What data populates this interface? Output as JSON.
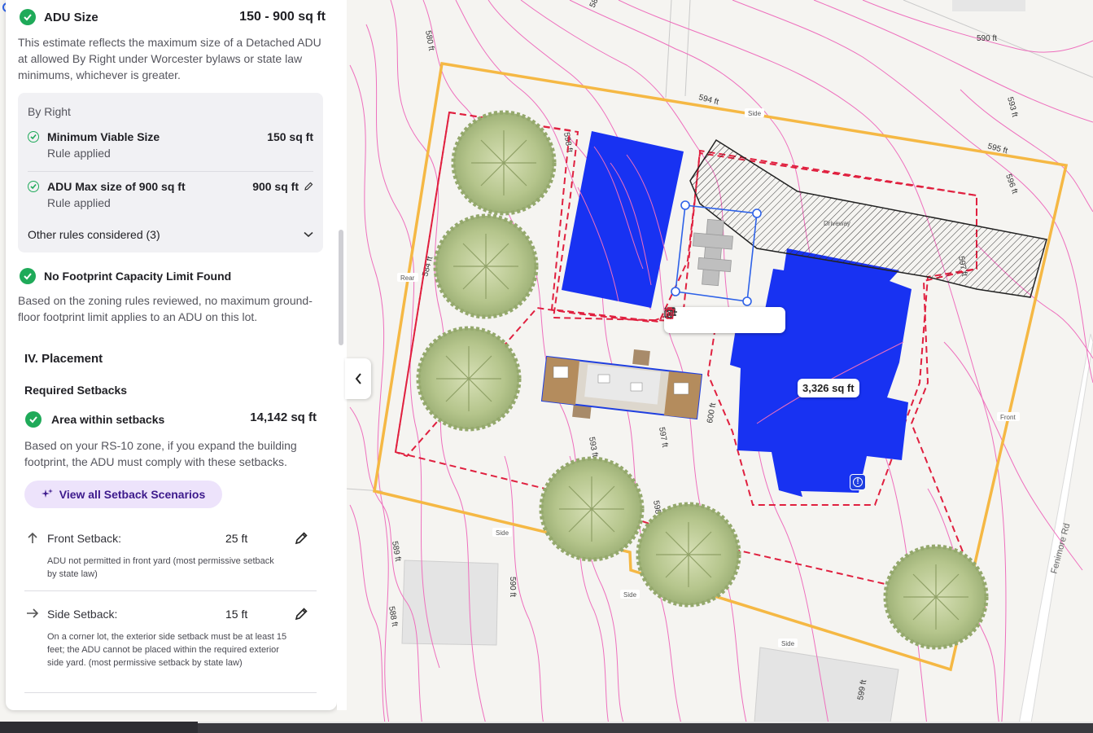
{
  "adu_size": {
    "title": "ADU Size",
    "value": "150 - 900 sq ft",
    "description": "This estimate reflects the maximum size of a Detached ADU at allowed By Right under Worcester bylaws or state law minimums, whichever is greater.",
    "rules_box": {
      "heading": "By Right",
      "rules": [
        {
          "name": "Minimum Viable Size",
          "status": "Rule applied",
          "value": "150 sq ft"
        },
        {
          "name": "ADU Max size of 900 sq ft",
          "status": "Rule applied",
          "value": "900 sq ft"
        }
      ],
      "other_rules_label": "Other rules considered (3)"
    }
  },
  "footprint": {
    "title": "No Footprint Capacity Limit Found",
    "description": "Based on the zoning rules reviewed, no maximum ground-floor footprint limit applies to an ADU on this lot."
  },
  "placement": {
    "section_title": "IV. Placement",
    "required_setbacks_title": "Required Setbacks",
    "area_label": "Area within setbacks",
    "area_value": "14,142 sq ft",
    "area_description": "Based on your RS-10 zone, if you expand the building footprint, the ADU must comply with these setbacks.",
    "view_all_button": "View all Setback Scenarios",
    "setbacks": [
      {
        "label": "Front Setback:",
        "value": "25 ft",
        "icon": "arrow-up-icon",
        "note": "ADU not permitted in front yard (most permissive setback by state law)"
      },
      {
        "label": "Side Setback:",
        "value": "15 ft",
        "icon": "arrow-right-icon",
        "note": "On a corner lot, the exterior side setback must be at least 15 feet; the ADU cannot be placed within the required exterior side yard. (most permissive setback by state law)"
      }
    ]
  },
  "map": {
    "building_area_label": "3,326 sq ft",
    "road_name": "Fenimore Rd",
    "driveway_label": "Driveway",
    "edge_tags": [
      "Side",
      "Rear",
      "Front",
      "Side",
      "Side",
      "Side"
    ],
    "contour_labels": [
      "580 ft",
      "583 ft",
      "590 ft",
      "594 ft",
      "593 ft",
      "595 ft",
      "596 ft",
      "597 ft",
      "584 ft",
      "598 ft",
      "596 ft",
      "601 ft",
      "600 ft",
      "593 ft",
      "597 ft",
      "598 ft",
      "589 ft",
      "590 ft",
      "588 ft",
      "599 ft"
    ],
    "toolbar": [
      "swap-icon",
      "align-icon",
      "chevron-down-icon",
      "duplicate-icon",
      "delete-icon"
    ],
    "colors": {
      "parcel": "#f5b844",
      "setback": "#e0203f",
      "building": "#1832f2",
      "contour": "#ee6fbd",
      "selection": "#2e62e8"
    }
  }
}
